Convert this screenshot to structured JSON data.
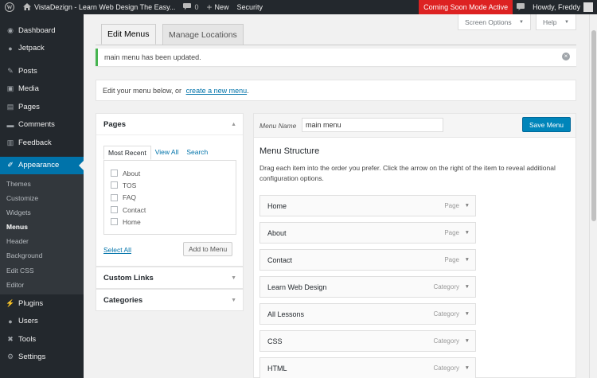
{
  "adminbar": {
    "site_name": "VistaDezign - Learn Web Design The Easy...",
    "comments_count": "0",
    "new_label": "New",
    "security_label": "Security",
    "coming_soon": "Coming Soon Mode Active",
    "howdy": "Howdy, Freddy"
  },
  "sidebar": {
    "top_items": [
      {
        "label": "Dashboard",
        "icon": "dashboard-icon"
      },
      {
        "label": "Jetpack",
        "icon": "jetpack-icon"
      }
    ],
    "content_items": [
      {
        "label": "Posts",
        "icon": "pin-icon"
      },
      {
        "label": "Media",
        "icon": "media-icon"
      },
      {
        "label": "Pages",
        "icon": "pages-icon"
      },
      {
        "label": "Comments",
        "icon": "comments-icon"
      },
      {
        "label": "Feedback",
        "icon": "feedback-icon"
      }
    ],
    "appearance": {
      "label": "Appearance",
      "icon": "brush-icon"
    },
    "appearance_sub": [
      "Themes",
      "Customize",
      "Widgets",
      "Menus",
      "Header",
      "Background",
      "Edit CSS",
      "Editor"
    ],
    "bottom_items": [
      {
        "label": "Plugins",
        "icon": "plugin-icon"
      },
      {
        "label": "Users",
        "icon": "users-icon"
      },
      {
        "label": "Tools",
        "icon": "tools-icon"
      },
      {
        "label": "Settings",
        "icon": "settings-icon"
      }
    ]
  },
  "screen_options": "Screen Options",
  "help": "Help",
  "tabs": {
    "edit": "Edit Menus",
    "manage": "Manage Locations"
  },
  "notice": {
    "menu_name": "main menu",
    "text": " has been updated."
  },
  "manage": {
    "text": "Edit your menu below, or ",
    "link": "create a new menu",
    "end": "."
  },
  "pages_box": {
    "title": "Pages",
    "tabs": [
      "Most Recent",
      "View All",
      "Search"
    ],
    "items": [
      "About",
      "TOS",
      "FAQ",
      "Contact",
      "Home"
    ],
    "select_all": "Select All",
    "add_button": "Add to Menu"
  },
  "custom_links": "Custom Links",
  "categories": "Categories",
  "menu": {
    "name_label": "Menu Name",
    "name_value": "main menu",
    "save_label": "Save Menu",
    "structure_title": "Menu Structure",
    "structure_desc": "Drag each item into the order you prefer. Click the arrow on the right of the item to reveal additional configuration options.",
    "items": [
      {
        "title": "Home",
        "type": "Page"
      },
      {
        "title": "About",
        "type": "Page"
      },
      {
        "title": "Contact",
        "type": "Page"
      },
      {
        "title": "Learn Web Design",
        "type": "Category"
      },
      {
        "title": "All Lessons",
        "type": "Category"
      },
      {
        "title": "CSS",
        "type": "Category"
      },
      {
        "title": "HTML",
        "type": "Category"
      }
    ]
  },
  "colors": {
    "admin_dark": "#23282d",
    "accent": "#0073aa",
    "coming_soon": "#dd2222",
    "success": "#46b450"
  }
}
